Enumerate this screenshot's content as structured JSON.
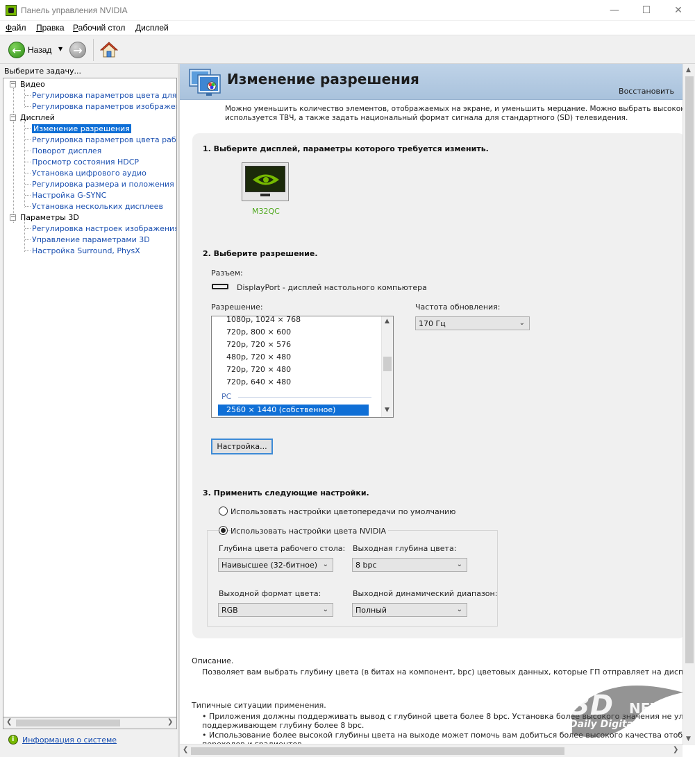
{
  "window": {
    "title": "Панель управления NVIDIA"
  },
  "menu": [
    {
      "label": "Файл",
      "mnemonic": "Ф",
      "rest": "айл"
    },
    {
      "label": "Правка",
      "mnemonic": "П",
      "rest": "равка"
    },
    {
      "label": "Рабочий стол",
      "mnemonic": "Р",
      "rest": "абочий стол"
    },
    {
      "label": "Дисплей",
      "mnemonic": "Д",
      "rest": "исплей"
    }
  ],
  "toolbar": {
    "back_label": "Назад"
  },
  "sidebar": {
    "task_label": "Выберите задачу...",
    "groups": [
      {
        "label": "Видео",
        "items": [
          "Регулировка параметров цвета для вид",
          "Регулировка параметров изображения д"
        ]
      },
      {
        "label": "Дисплей",
        "items": [
          "Изменение разрешения",
          "Регулировка параметров цвета рабочег",
          "Поворот дисплея",
          "Просмотр состояния HDCP",
          "Установка цифрового аудио",
          "Регулировка размера и положения рабо",
          "Настройка G-SYNC",
          "Установка нескольких дисплеев"
        ]
      },
      {
        "label": "Параметры 3D",
        "items": [
          "Регулировка настроек изображения с пр",
          "Управление параметрами 3D",
          "Настройка Surround, PhysX"
        ]
      }
    ],
    "system_info": "Информация о системе"
  },
  "main": {
    "title": "Изменение разрешения",
    "restore": "Восстановить",
    "intro_line1": "Можно уменьшить количество элементов, отображаемых на экране, и уменьшить мерцание. Можно выбрать высококачественн",
    "intro_line2": "используется ТВЧ, а также задать национальный формат сигнала для стандартного (SD) телевидения.",
    "step1": "1. Выберите дисплей, параметры которого требуется изменить.",
    "monitor_name": "M32QC",
    "step2": "2. Выберите разрешение.",
    "connector_label": "Разъем:",
    "connector_value": "DisplayPort - дисплей настольного компьютера",
    "resolution_label": "Разрешение:",
    "resolutions": [
      "1080p, 1024 × 768",
      "720p, 800 × 600",
      "720p, 720 × 576",
      "480p, 720 × 480",
      "720p, 720 × 480",
      "720p, 640 × 480"
    ],
    "group_pc": "PC",
    "selected_resolution": "2560 × 1440 (собственное)",
    "refresh_label": "Частота обновления:",
    "refresh_value": "170 Гц",
    "customize_button": "Настройка...",
    "step3": "3. Применить следующие настройки.",
    "radio_default": "Использовать настройки цветопередачи по умолчанию",
    "radio_nvidia": "Использовать настройки цвета NVIDIA",
    "desktop_depth_label": "Глубина цвета рабочего стола:",
    "desktop_depth_value": "Наивысшее (32-битное)",
    "output_depth_label": "Выходная глубина цвета:",
    "output_depth_value": "8 bpc",
    "output_format_label": "Выходной формат цвета:",
    "output_format_value": "RGB",
    "dynamic_range_label": "Выходной динамический диапазон:",
    "dynamic_range_value": "Полный",
    "desc_title": "Описание.",
    "desc_text": "Позволяет вам выбрать глубину цвета (в битах на компонент, bpc) цветовых данных, которые ГП отправляет на дисплей.",
    "usage_title": "Типичные ситуации применения.",
    "usage_1a": "• Приложения должны поддерживать вывод с глубиной цвета более 8 bpc. Установка более высокого значения не улучшит изображе",
    "usage_1b": "поддерживающем глубину более 8 bpc.",
    "usage_2a": "• Использование более высокой глубины цвета на выходе может помочь вам добиться более высокого качества отображения цветов",
    "usage_2b": "переходов и градиентов."
  },
  "watermark": {
    "brand": "3D",
    "brand2": "NEWS",
    "tagline": "Daily Digital Digest"
  },
  "colors": {
    "nvidia_green": "#76b900",
    "selection": "#0f6fd6",
    "header": "#b3c9e1",
    "link": "#1a4fb0"
  }
}
